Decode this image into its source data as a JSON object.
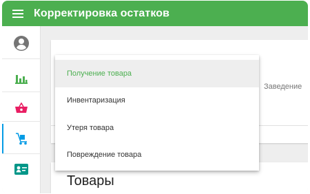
{
  "header": {
    "title": "Корректировка остатков",
    "menu_icon": "menu-icon"
  },
  "sidebar": {
    "items": [
      {
        "icon": "account-circle-icon",
        "color": "#757575",
        "active": false
      },
      {
        "icon": "bar-chart-icon",
        "color": "#4caf50",
        "active": false
      },
      {
        "icon": "basket-icon",
        "color": "#e91e63",
        "active": false
      },
      {
        "icon": "cart-dolly-icon",
        "color": "#039be5",
        "active": true
      },
      {
        "icon": "contact-card-icon",
        "color": "#009688",
        "active": false
      }
    ]
  },
  "main": {
    "column_header": "Заведение",
    "section_heading": "Товары"
  },
  "dropdown": {
    "options": [
      {
        "label": "Получение товара",
        "selected": true
      },
      {
        "label": "Инвентаризация",
        "selected": false
      },
      {
        "label": "Утеря товара",
        "selected": false
      },
      {
        "label": "Повреждение товара",
        "selected": false
      }
    ]
  },
  "colors": {
    "primary": "#4caf50",
    "accent_blue": "#039be5"
  }
}
